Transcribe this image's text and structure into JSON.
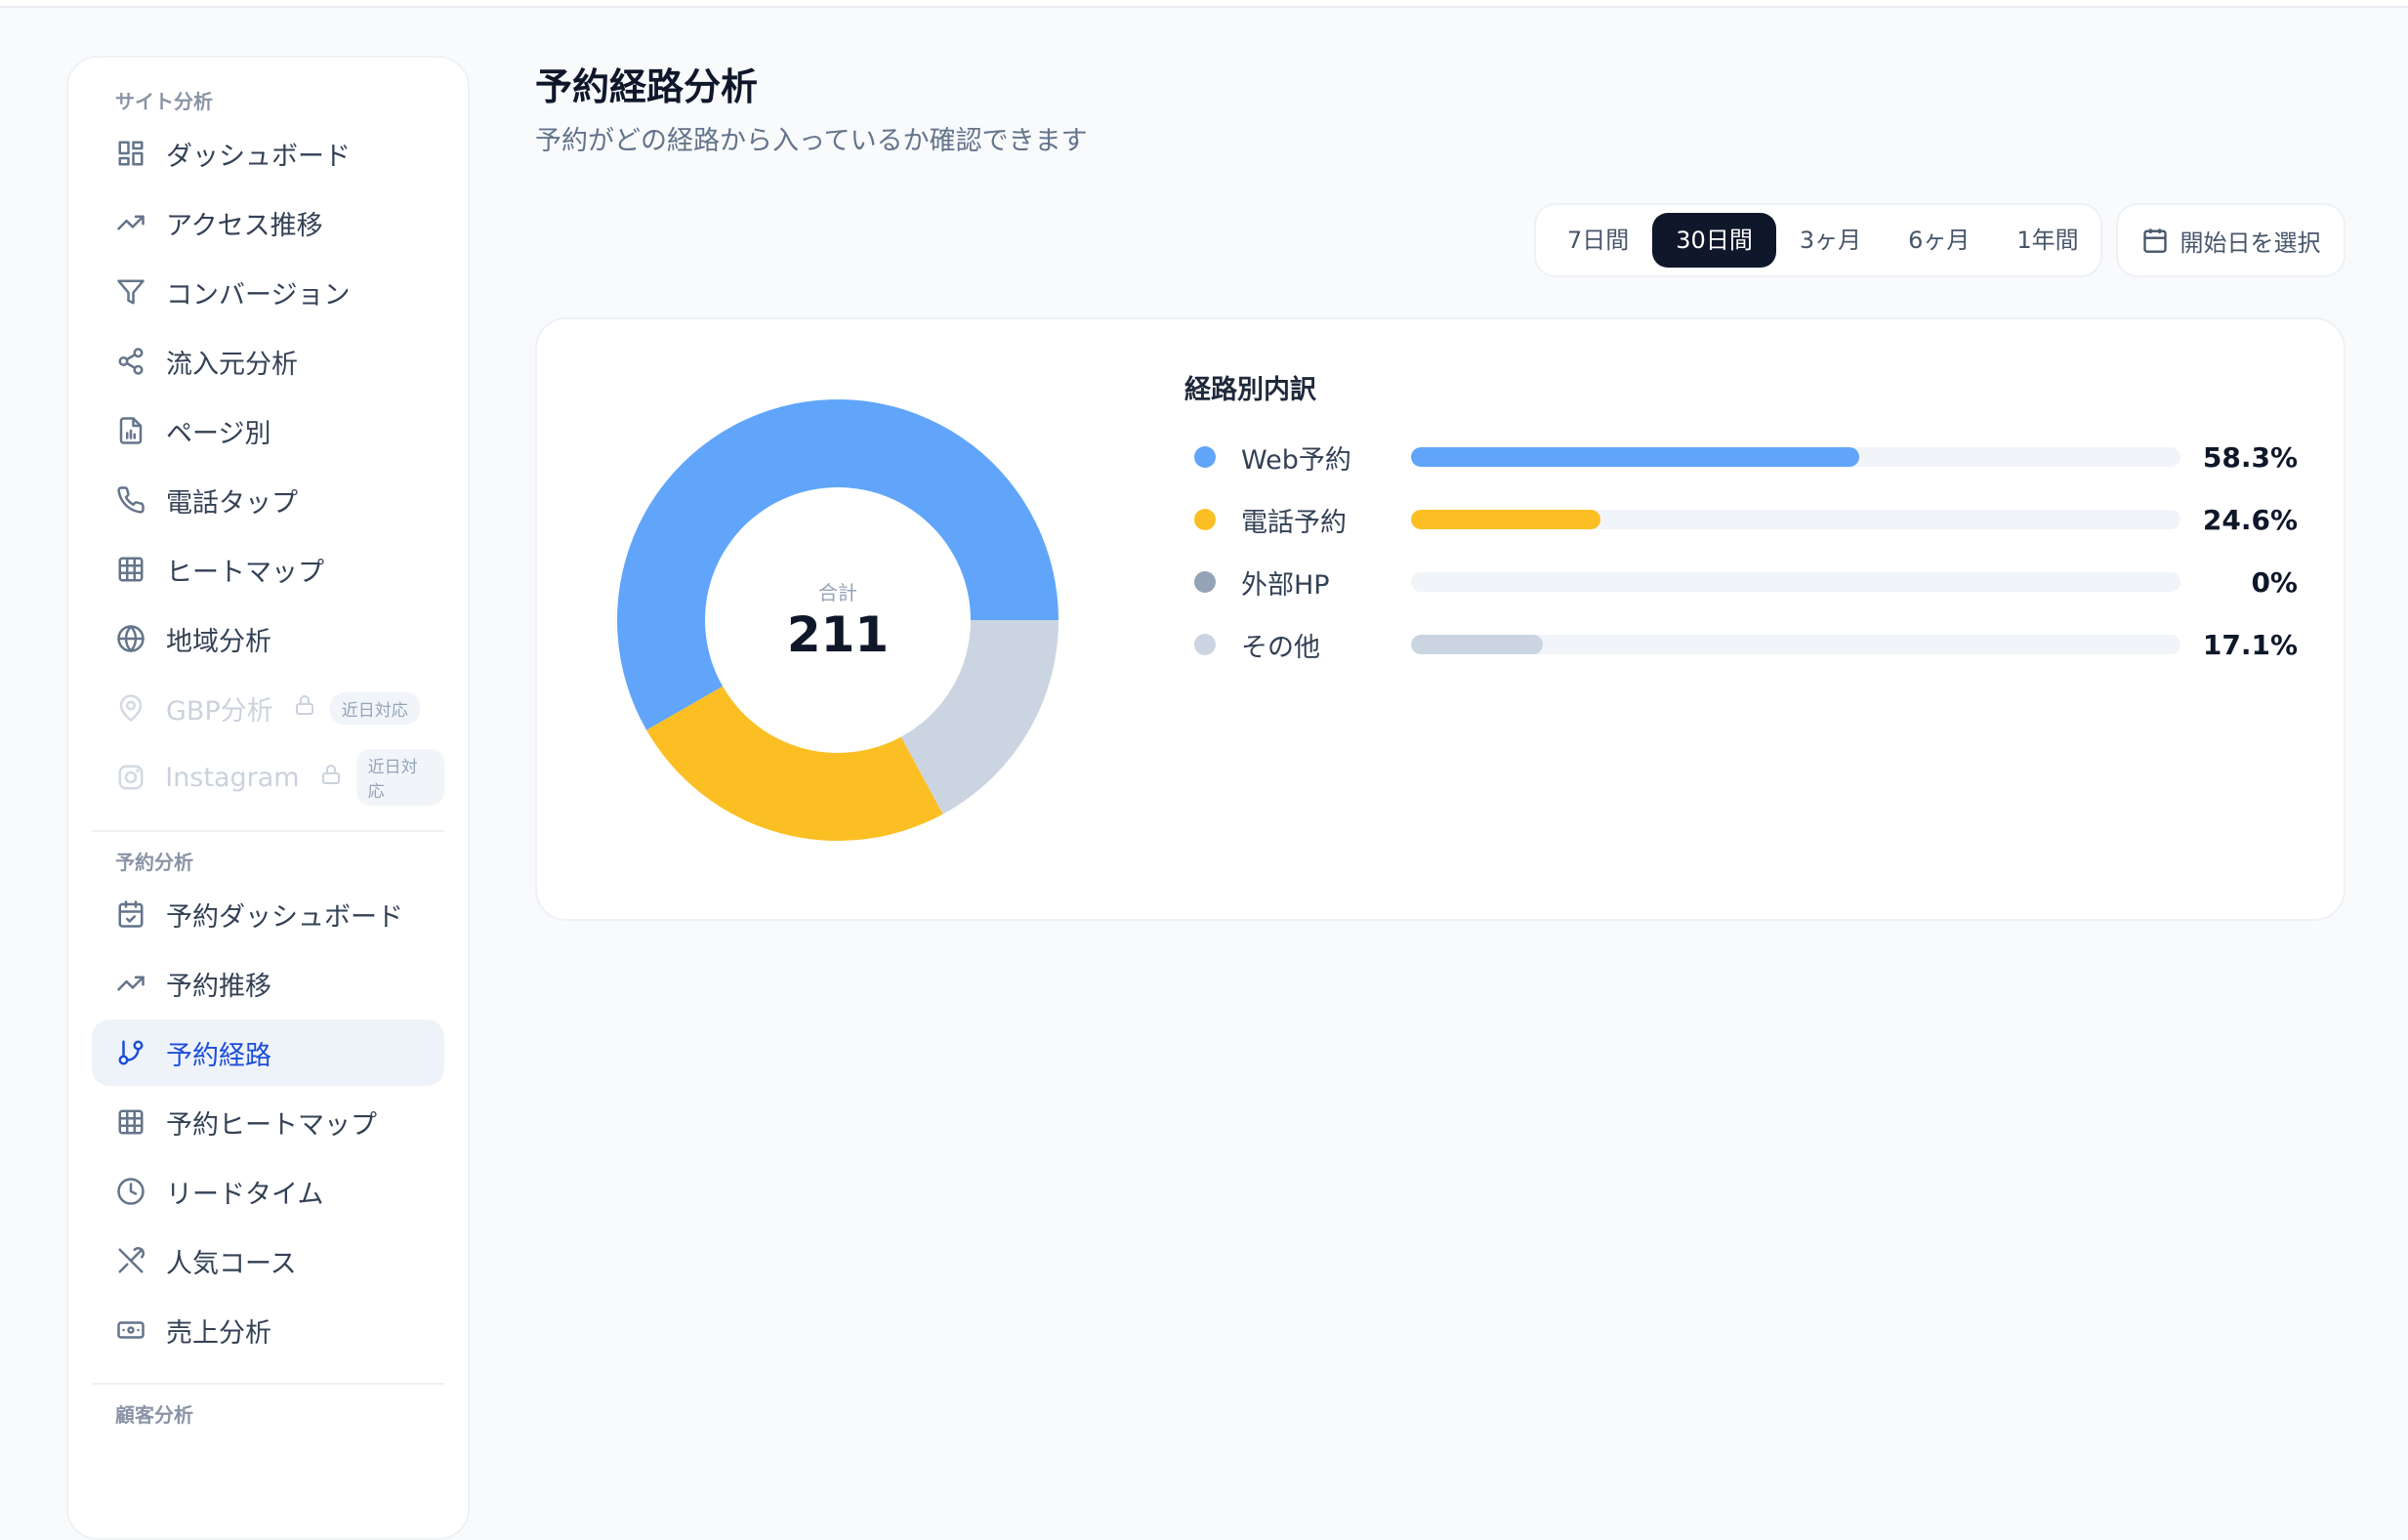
{
  "sidebar": {
    "site_section": "サイト分析",
    "site_items": [
      {
        "label": "ダッシュボード",
        "icon": "dashboard-icon"
      },
      {
        "label": "アクセス推移",
        "icon": "trend-icon"
      },
      {
        "label": "コンバージョン",
        "icon": "funnel-icon"
      },
      {
        "label": "流入元分析",
        "icon": "share-icon"
      },
      {
        "label": "ページ別",
        "icon": "file-chart-icon"
      },
      {
        "label": "電話タップ",
        "icon": "phone-icon"
      },
      {
        "label": "ヒートマップ",
        "icon": "grid-icon"
      },
      {
        "label": "地域分析",
        "icon": "globe-icon"
      },
      {
        "label": "GBP分析",
        "icon": "map-pin-icon",
        "badge": "近日対応"
      },
      {
        "label": "Instagram",
        "icon": "instagram-icon",
        "badge": "近日対応"
      }
    ],
    "reservation_section": "予約分析",
    "reservation_items": [
      {
        "label": "予約ダッシュボード",
        "icon": "calendar-check-icon"
      },
      {
        "label": "予約推移",
        "icon": "trend-icon"
      },
      {
        "label": "予約経路",
        "icon": "git-branch-icon",
        "active": true
      },
      {
        "label": "予約ヒートマップ",
        "icon": "grid-icon"
      },
      {
        "label": "リードタイム",
        "icon": "clock-icon"
      },
      {
        "label": "人気コース",
        "icon": "utensils-icon"
      },
      {
        "label": "売上分析",
        "icon": "banknote-icon"
      }
    ],
    "customer_section": "顧客分析"
  },
  "header": {
    "title": "予約経路分析",
    "subtitle": "予約がどの経路から入っているか確認できます"
  },
  "range": {
    "options": [
      "7日間",
      "30日間",
      "3ヶ月",
      "6ヶ月",
      "1年間"
    ],
    "selected": "30日間",
    "date_button": "開始日を選択"
  },
  "colors": {
    "accent_dark": "#0f172a",
    "active_blue": "#1d4ed8"
  },
  "chart_data": {
    "type": "pie",
    "center_label": "合計",
    "total": "211",
    "breakdown_title": "経路別内訳",
    "series": [
      {
        "name": "Web予約",
        "value": 58.3,
        "display": "58.3%",
        "color": "#60a5fa"
      },
      {
        "name": "電話予約",
        "value": 24.6,
        "display": "24.6%",
        "color": "#fbbf24"
      },
      {
        "name": "外部HP",
        "value": 0,
        "display": "0%",
        "color": "#94a3b8"
      },
      {
        "name": "その他",
        "value": 17.1,
        "display": "17.1%",
        "color": "#cbd5e1"
      }
    ]
  }
}
